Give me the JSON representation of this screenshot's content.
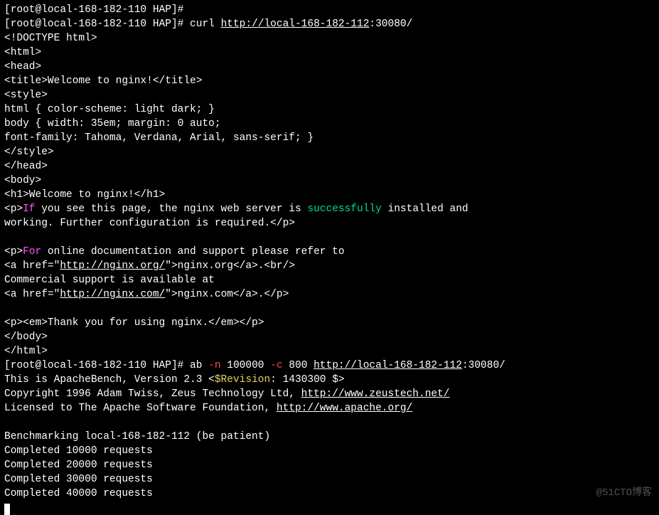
{
  "prompt": {
    "user": "root",
    "host": "local-168-182-110",
    "dir": "HAP",
    "prefix": "[root@local-168-182-110 HAP]#"
  },
  "curl": {
    "cmd": "curl ",
    "url": "http://local-168-182-112",
    "port": ":30080/"
  },
  "html": {
    "doctype": "<!DOCTYPE html>",
    "html_open": "<html>",
    "head_open": "<head>",
    "title": "<title>Welcome to nginx!</title>",
    "style_open": "<style>",
    "css1": "html { color-scheme: light dark; }",
    "css2": "body { width: 35em; margin: 0 auto;",
    "css3": "font-family: Tahoma, Verdana, Arial, sans-serif; }",
    "style_close": "</style>",
    "head_close": "</head>",
    "body_open": "<body>",
    "h1": "<h1>Welcome to nginx!</h1>",
    "p1_a": "<p>",
    "p1_if": "If",
    "p1_b": " you see this page, the nginx web server is ",
    "p1_success": "successfully",
    "p1_c": " installed and",
    "p1_line2": "working. Further configuration is required.</p>",
    "p2_a": "<p>",
    "p2_for": "For",
    "p2_b": " online documentation and support please refer to",
    "a1_open": "<a href=\"",
    "a1_href": "http://nginx.org/",
    "a1_mid": "\">nginx.org</a>.<br/>",
    "comm": "Commercial support is available at",
    "a2_open": "<a href=\"",
    "a2_href": "http://nginx.com/",
    "a2_mid": "\">nginx.com</a>.</p>",
    "thank": "<p><em>Thank you for using nginx.</em></p>",
    "body_close": "</body>",
    "html_close": "</html>"
  },
  "ab": {
    "cmd": "ab ",
    "n_flag": "-n",
    "n_val": " 100000 ",
    "c_flag": "-c",
    "c_val": " 800 ",
    "url": "http://local-168-182-112",
    "port": ":30080/",
    "version_a": "This is ApacheBench, Version 2.3 <",
    "version_rev": "$Revision",
    "version_b": ": 1430300 $>",
    "copyright_a": "Copyright 1996 Adam Twiss, Zeus Technology Ltd, ",
    "copyright_url": "http://www.zeustech.net/",
    "licensed_a": "Licensed to The Apache Software Foundation, ",
    "licensed_url": "http://www.apache.org/",
    "bench": "Benchmarking local-168-182-112 (be patient)",
    "c1": "Completed 10000 requests",
    "c2": "Completed 20000 requests",
    "c3": "Completed 30000 requests",
    "c4": "Completed 40000 requests"
  },
  "watermark": "@51CTO博客"
}
